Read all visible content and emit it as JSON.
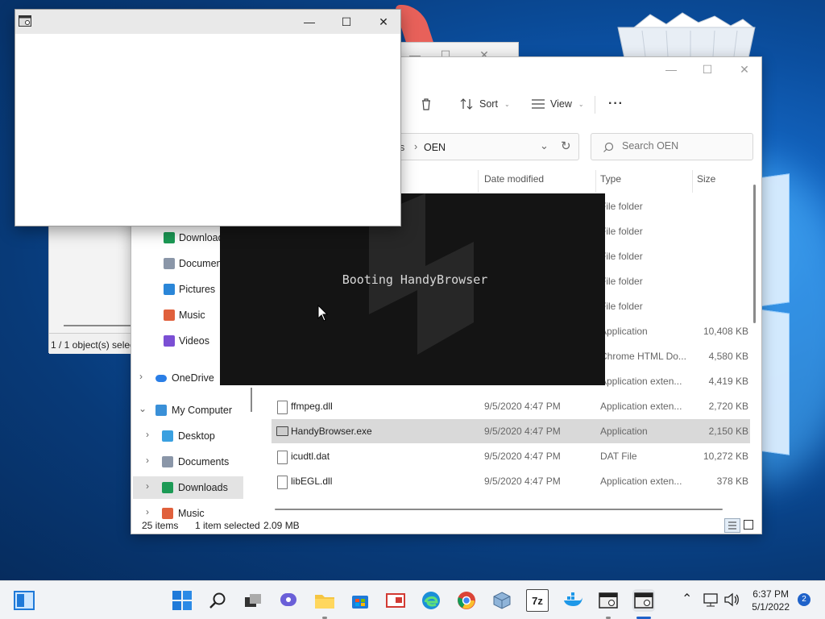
{
  "explorer": {
    "toolbar": {
      "sort": "Sort",
      "view": "View",
      "more": "···"
    },
    "address": {
      "crumb_prefix": "s",
      "sep": "›",
      "current": "OEN"
    },
    "search": {
      "placeholder": "Search OEN"
    },
    "columns": {
      "date": "Date modified",
      "type": "Type",
      "size": "Size"
    },
    "rows": [
      {
        "name": "",
        "date": "",
        "type": "File folder",
        "size": "",
        "kind": "folder"
      },
      {
        "name": "",
        "date": "",
        "type": "File folder",
        "size": "",
        "kind": "folder"
      },
      {
        "name": "",
        "date": "",
        "type": "File folder",
        "size": "",
        "kind": "folder"
      },
      {
        "name": "",
        "date": "",
        "type": "File folder",
        "size": "",
        "kind": "folder"
      },
      {
        "name": "",
        "date": "",
        "type": "File folder",
        "size": "",
        "kind": "folder"
      },
      {
        "name": "",
        "date": "",
        "type": "Application",
        "size": "10,408 KB",
        "kind": "file"
      },
      {
        "name": "",
        "date": "",
        "type": "Chrome HTML Do...",
        "size": "4,580 KB",
        "kind": "file"
      },
      {
        "name": "",
        "date": "",
        "type": "Application exten...",
        "size": "4,419 KB",
        "kind": "file"
      },
      {
        "name": "ffmpeg.dll",
        "date": "9/5/2020 4:47 PM",
        "type": "Application exten...",
        "size": "2,720 KB",
        "kind": "file"
      },
      {
        "name": "HandyBrowser.exe",
        "date": "9/5/2020 4:47 PM",
        "type": "Application",
        "size": "2,150 KB",
        "kind": "exe",
        "selected": true
      },
      {
        "name": "icudtl.dat",
        "date": "9/5/2020 4:47 PM",
        "type": "DAT File",
        "size": "10,272 KB",
        "kind": "file"
      },
      {
        "name": "libEGL.dll",
        "date": "9/5/2020 4:47 PM",
        "type": "Application exten...",
        "size": "378 KB",
        "kind": "file"
      }
    ],
    "nav": {
      "quick": [
        {
          "label": "Downloads",
          "icon": "download-arrow-icon"
        },
        {
          "label": "Documents",
          "icon": "documents-icon"
        },
        {
          "label": "Pictures",
          "icon": "pictures-icon"
        },
        {
          "label": "Music",
          "icon": "music-icon"
        },
        {
          "label": "Videos",
          "icon": "videos-icon"
        }
      ],
      "onedrive": "OneDrive",
      "computer": "My Computer",
      "computer_items": [
        {
          "label": "Desktop",
          "icon": "desktop-icon"
        },
        {
          "label": "Documents",
          "icon": "documents-icon"
        },
        {
          "label": "Downloads",
          "icon": "download-arrow-icon"
        },
        {
          "label": "Music",
          "icon": "music-icon"
        }
      ]
    },
    "status": {
      "count": "25 items",
      "selection": "1 item selected",
      "size": "2.09 MB"
    }
  },
  "backwin": {
    "status": "1 / 1 object(s) selec"
  },
  "splash": {
    "text": "Booting HandyBrowser"
  },
  "taskbar": {
    "time": "6:37 PM",
    "date": "5/1/2022",
    "notifications": "2",
    "zip_label": "7z"
  }
}
